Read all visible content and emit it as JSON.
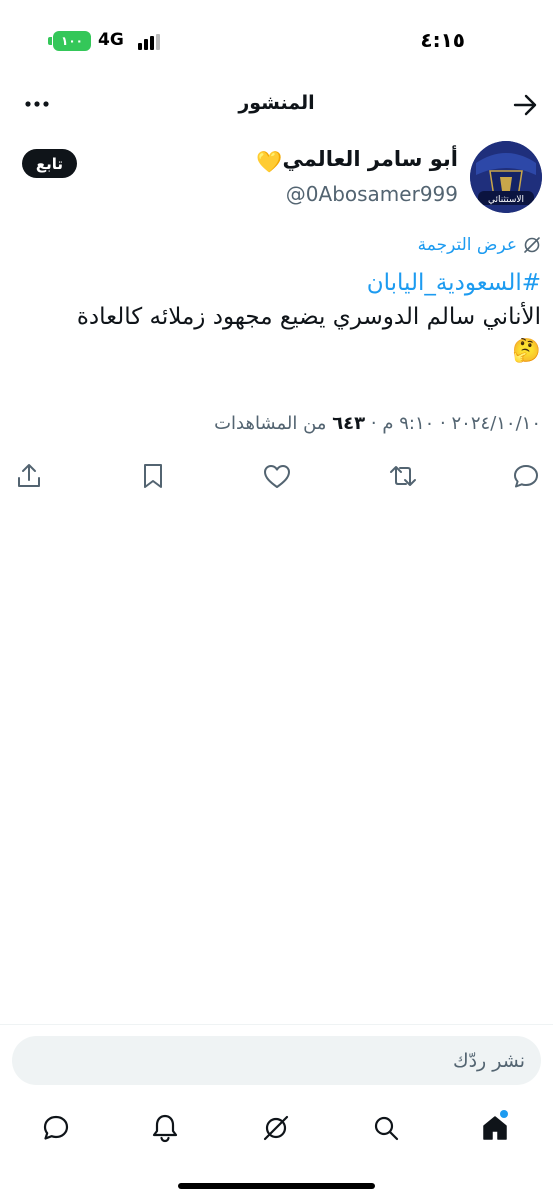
{
  "status_bar": {
    "time": "٤:١٥",
    "network": "4G",
    "battery": "١٠٠"
  },
  "header": {
    "title": "المنشور"
  },
  "author": {
    "name": "أبو سامر العالمي",
    "name_emoji": "💛",
    "username": "@0Abosamer999",
    "avatar_caption": "الاستثنائي",
    "follow_label": "تابع"
  },
  "post": {
    "translate_label": "عرض الترجمة",
    "hashtag": "#السعودية_اليابان",
    "text": "الأناني سالم الدوسري يضيع مجهود زملائه كالعادة",
    "emoji": "🤔",
    "date": "٢٠٢٤/١٠/١٠",
    "time": "٩:١٠ م",
    "views_count": "٦٤٣",
    "views_label": "من المشاهدات",
    "separator": "·"
  },
  "actions": {
    "icons": [
      "reply-icon",
      "repost-icon",
      "like-icon",
      "bookmark-icon",
      "share-icon"
    ]
  },
  "compose": {
    "placeholder": "نشر ردّك"
  },
  "tabbar": {
    "icons": [
      "home-icon",
      "search-icon",
      "grok-icon",
      "notifications-icon",
      "messages-icon"
    ]
  },
  "colors": {
    "accent": "#1d9bf0",
    "text": "#0f1419",
    "muted": "#536471",
    "battery": "#34c759"
  }
}
